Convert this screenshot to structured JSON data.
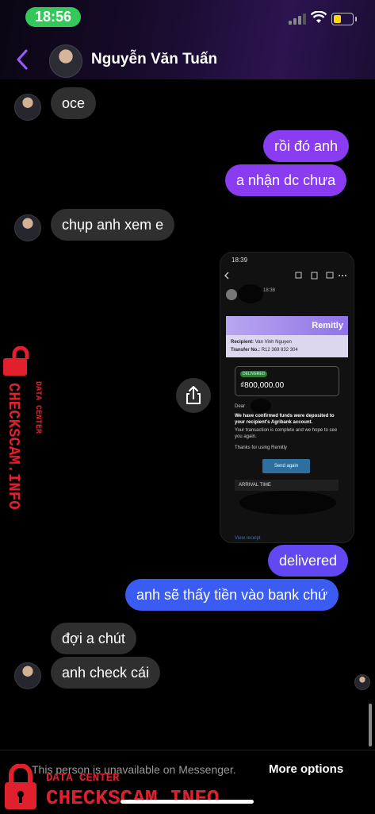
{
  "status_bar": {
    "time": "18:56"
  },
  "header": {
    "contact_name": "Nguyễn Văn Tuấn"
  },
  "messages": [
    {
      "text": "oce"
    },
    {
      "text": "rồi đó anh"
    },
    {
      "text": "a nhận dc chưa"
    },
    {
      "text": "chụp anh xem e"
    },
    {
      "text": "delivered"
    },
    {
      "text": "anh sẽ thấy tiền vào bank chứ"
    },
    {
      "text": "đợi a chút"
    },
    {
      "text": "anh check cái"
    }
  ],
  "image_message": {
    "time": "18:39",
    "sent_time": "18:38",
    "brand": "Remitly",
    "recipient_label": "Recipient:",
    "recipient": "Van Vinh Nguyen",
    "transfer_label": "Transfer No.:",
    "transfer_no": "R12 369 832 304",
    "status_badge": "DELIVERED",
    "amount": "₫800,000.00",
    "greeting": "Dear",
    "confirm_text": "We have confirmed funds were deposited to your recipient's Agribank account.",
    "complete_text": "Your transaction is complete and we hope to see you again.",
    "thanks_text": "Thanks for using Remitly",
    "button": "Send again",
    "arrival_label": "ARRIVAL TIME",
    "footer_link": "View receipt"
  },
  "footer": {
    "notice": "This person is unavailable on Messenger.",
    "more_options": "More options"
  },
  "watermarks": {
    "vertical_top": "DATA CENTER",
    "vertical_main": "CHECKSCAM.INFO",
    "bottom_top": "DATA CENTER",
    "bottom_main": "CHECKSCAM.INFO"
  },
  "colors": {
    "accent_purple": "#8a3cf0",
    "accent_blue": "#3b5cf3",
    "incoming_bubble": "#2f2f2f",
    "watermark_red": "#e0212d"
  }
}
